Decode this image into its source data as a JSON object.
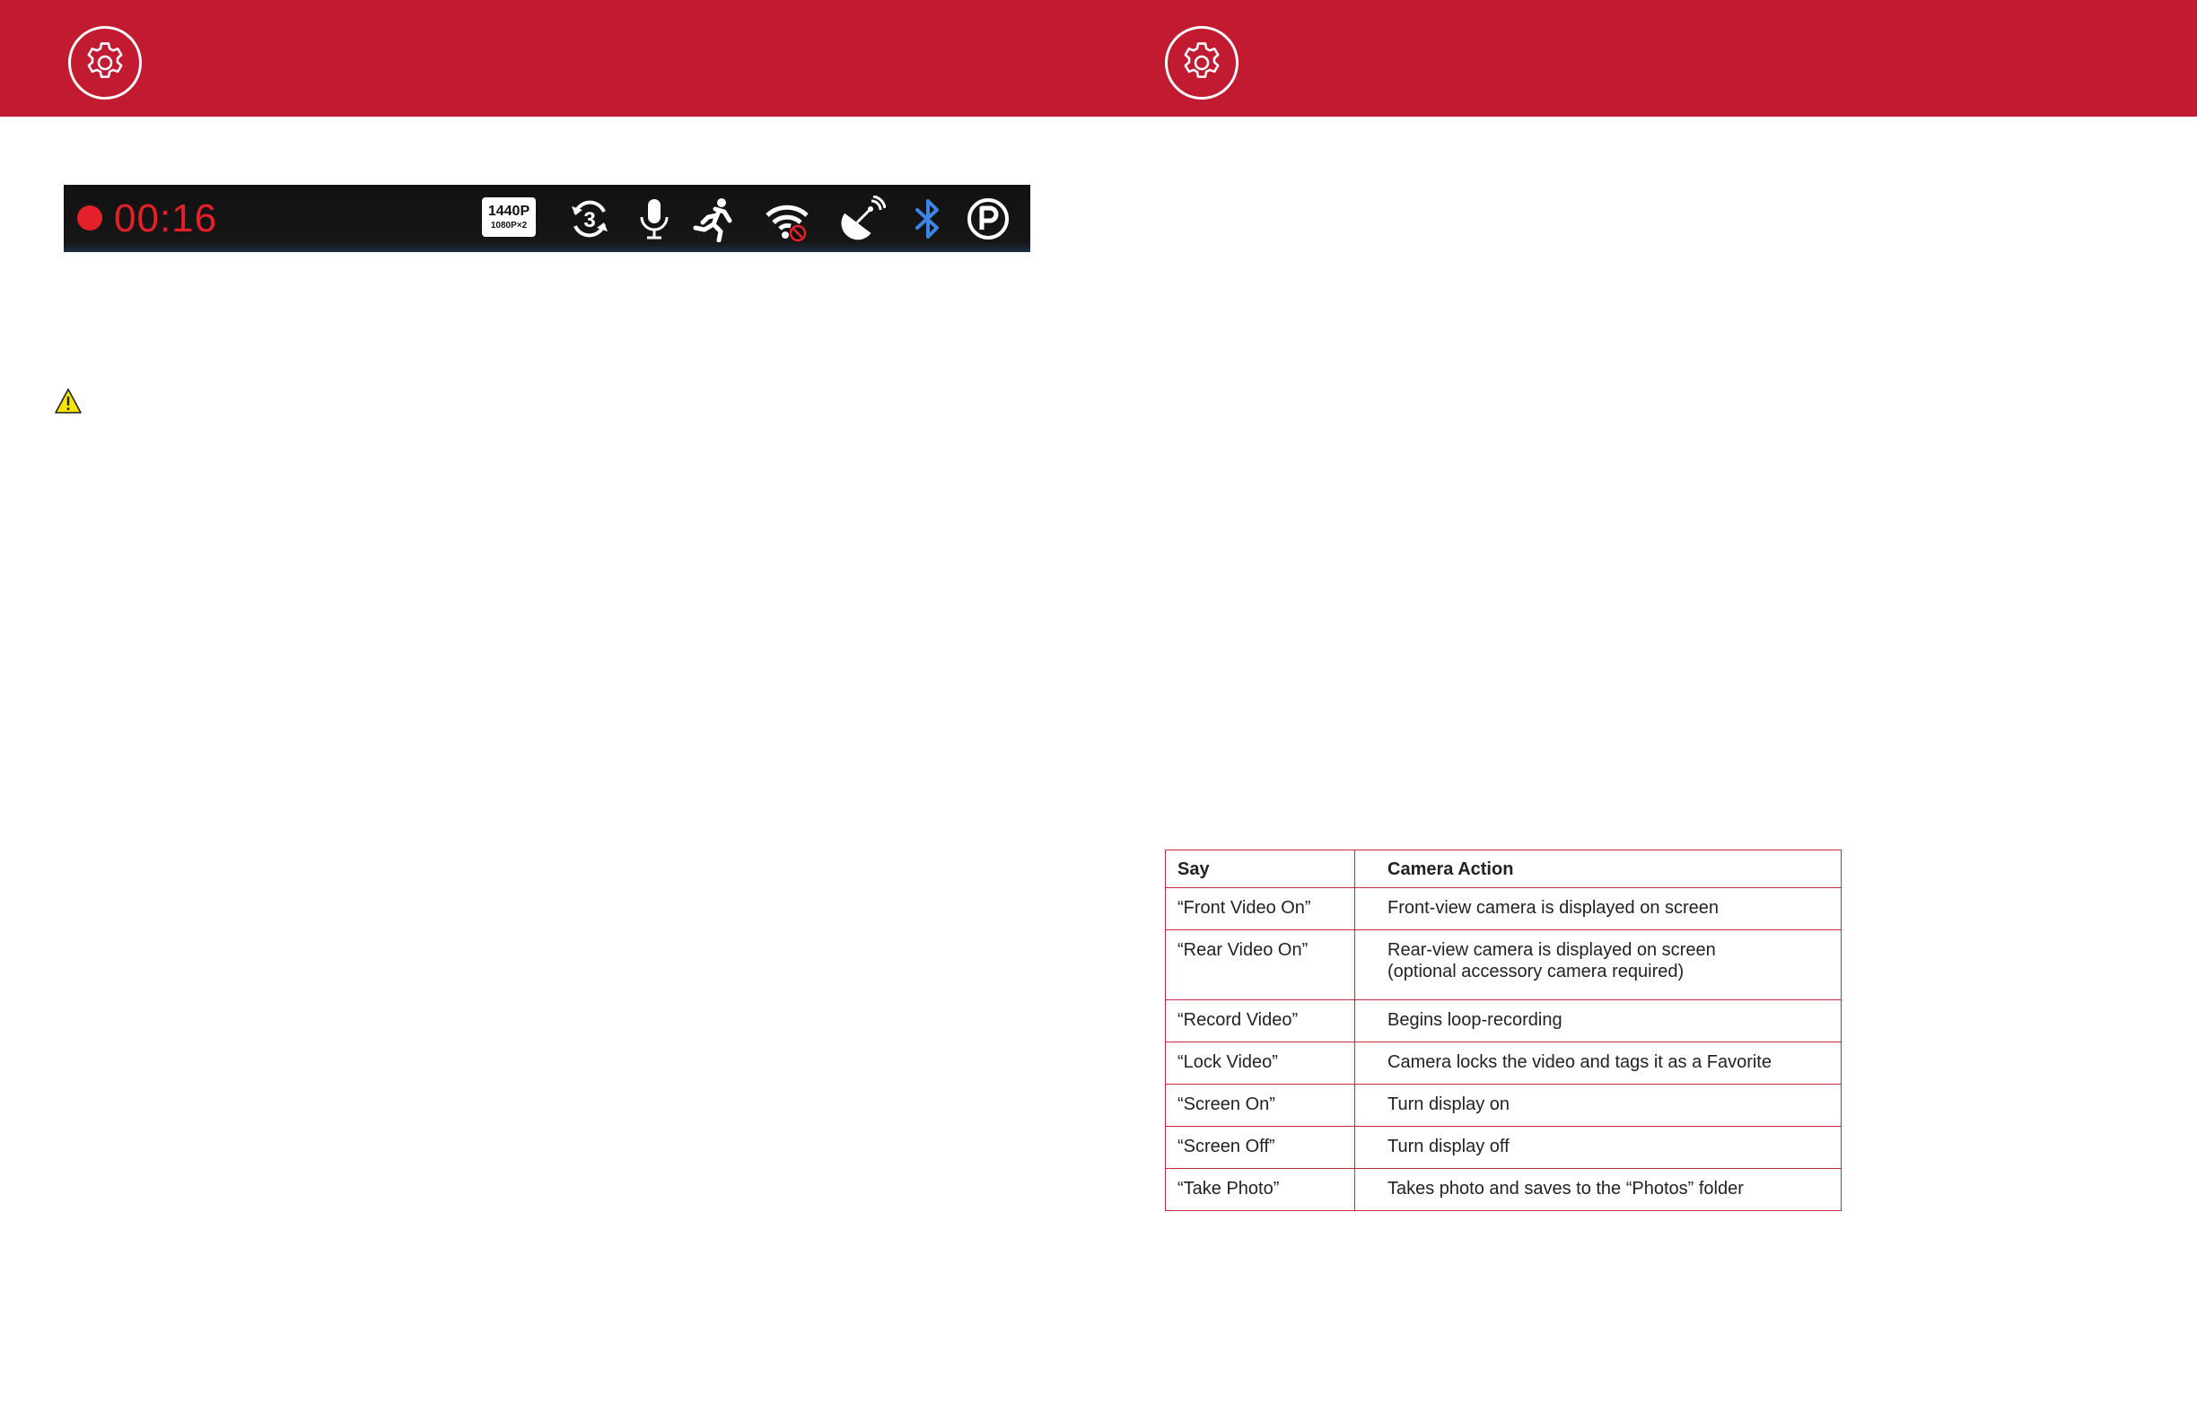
{
  "icons": {
    "header_left": "gear-icon",
    "header_right": "gear-icon",
    "warning": "warning-icon"
  },
  "colors": {
    "brand_red": "#c21a30",
    "table_border": "#c8283e",
    "record_red": "#e5202a",
    "bluetooth_blue": "#3d86e6",
    "warning_yellow": "#f6e300"
  },
  "status_bar": {
    "record_time": "00:16",
    "resolution_main": "1440P",
    "resolution_sub": "1080P×2",
    "loop_minutes": "3",
    "icons": [
      "record-dot-icon",
      "resolution-icon",
      "loop-recording-icon",
      "microphone-icon",
      "motion-detection-icon",
      "wifi-off-icon",
      "gps-icon",
      "bluetooth-icon",
      "parking-mode-icon"
    ]
  },
  "voice_commands": {
    "headers": {
      "say": "Say",
      "action": "Camera Action"
    },
    "rows": [
      {
        "say": "“Front Video On”",
        "action": [
          "Front-view camera is displayed on screen"
        ]
      },
      {
        "say": "“Rear Video On”",
        "action": [
          "Rear-view camera is displayed on screen",
          "(optional accessory camera required)"
        ]
      },
      {
        "say": "“Record Video”",
        "action": [
          "Begins loop-recording"
        ]
      },
      {
        "say": "“Lock Video”",
        "action": [
          "Camera locks the video and tags it as a Favorite"
        ]
      },
      {
        "say": "“Screen On”",
        "action": [
          "Turn display on"
        ]
      },
      {
        "say": "“Screen Off”",
        "action": [
          "Turn display off"
        ]
      },
      {
        "say": "“Take Photo”",
        "action": [
          "Takes photo and saves to the “Photos” folder"
        ]
      }
    ]
  }
}
